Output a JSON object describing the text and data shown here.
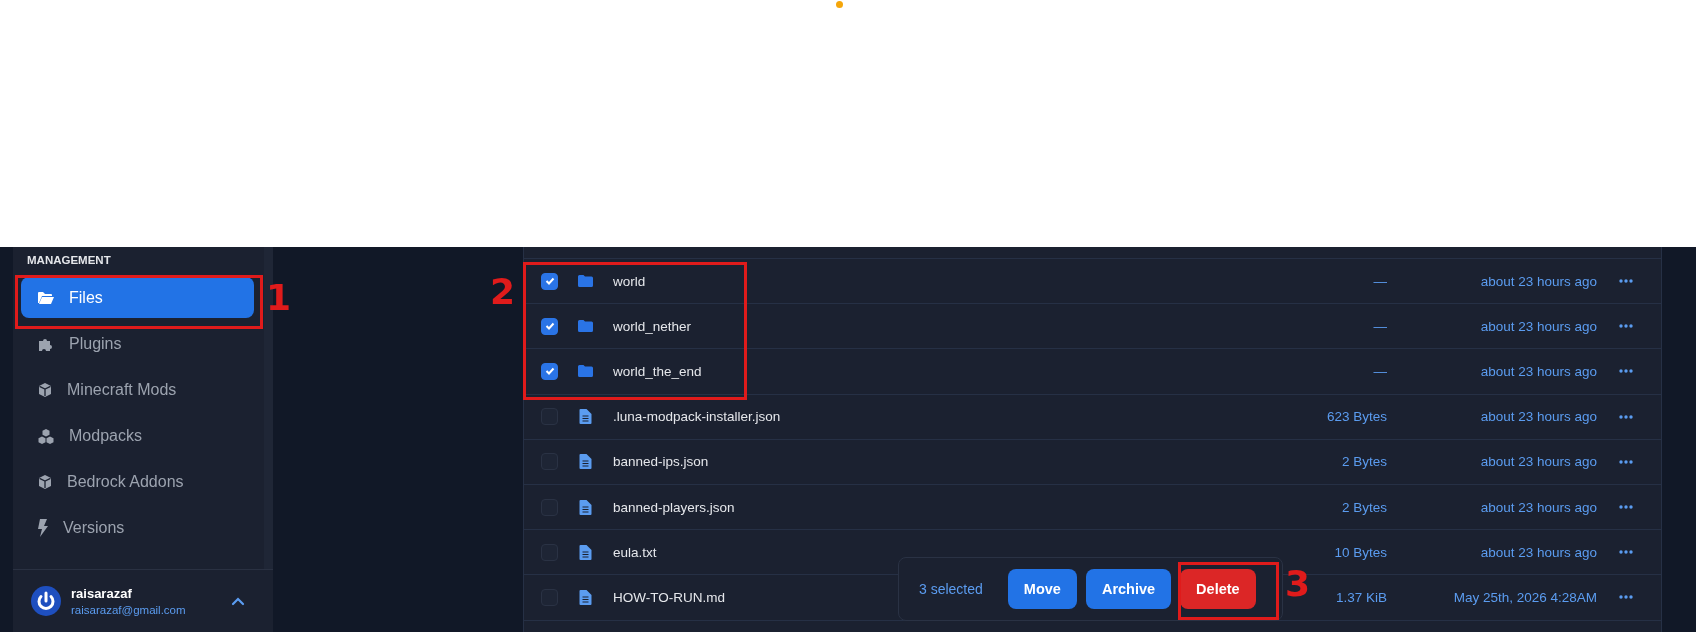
{
  "sidebar": {
    "section_title": "MANAGEMENT",
    "items": [
      {
        "label": "Files",
        "selected": true
      },
      {
        "label": "Plugins",
        "selected": false
      },
      {
        "label": "Minecraft Mods",
        "selected": false
      },
      {
        "label": "Modpacks",
        "selected": false
      },
      {
        "label": "Bedrock Addons",
        "selected": false
      },
      {
        "label": "Versions",
        "selected": false
      }
    ],
    "user": {
      "name": "raisarazaf",
      "email": "raisarazaf@gmail.com"
    }
  },
  "files": [
    {
      "name": "world",
      "kind": "folder",
      "size": "—",
      "modified": "about 23 hours ago",
      "selected": true
    },
    {
      "name": "world_nether",
      "kind": "folder",
      "size": "—",
      "modified": "about 23 hours ago",
      "selected": true
    },
    {
      "name": "world_the_end",
      "kind": "folder",
      "size": "—",
      "modified": "about 23 hours ago",
      "selected": true
    },
    {
      "name": ".luna-modpack-installer.json",
      "kind": "file",
      "size": "623 Bytes",
      "modified": "about 23 hours ago",
      "selected": false
    },
    {
      "name": "banned-ips.json",
      "kind": "file",
      "size": "2 Bytes",
      "modified": "about 23 hours ago",
      "selected": false
    },
    {
      "name": "banned-players.json",
      "kind": "file",
      "size": "2 Bytes",
      "modified": "about 23 hours ago",
      "selected": false
    },
    {
      "name": "eula.txt",
      "kind": "file",
      "size": "10 Bytes",
      "modified": "about 23 hours ago",
      "selected": false
    },
    {
      "name": "HOW-TO-RUN.md",
      "kind": "file",
      "size": "1.37 KiB",
      "modified": "May 25th, 2026 4:28AM",
      "selected": false
    }
  ],
  "bulk_bar": {
    "count": "3 selected",
    "buttons": [
      {
        "label": "Move",
        "kind": "primary"
      },
      {
        "label": "Archive",
        "kind": "primary"
      },
      {
        "label": "Delete",
        "kind": "danger"
      }
    ]
  },
  "annotations": [
    {
      "label": "1"
    },
    {
      "label": "2"
    },
    {
      "label": "3"
    }
  ]
}
